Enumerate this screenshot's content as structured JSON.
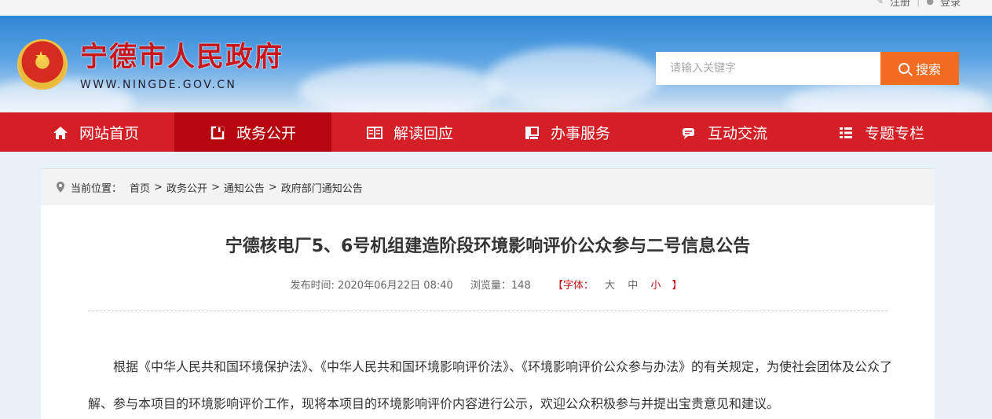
{
  "topbar": {
    "register": "注册",
    "separator": "|",
    "login": "登录"
  },
  "header": {
    "title": "宁德市人民政府",
    "url": "WWW.NINGDE.GOV.CN",
    "search_placeholder": "请输入关键字",
    "search_button": "搜索"
  },
  "nav": {
    "items": [
      {
        "label": "网站首页",
        "icon": "home-icon"
      },
      {
        "label": "政务公开",
        "icon": "open-icon"
      },
      {
        "label": "解读回应",
        "icon": "book-icon"
      },
      {
        "label": "办事服务",
        "icon": "service-icon"
      },
      {
        "label": "互动交流",
        "icon": "chat-icon"
      },
      {
        "label": "专题专栏",
        "icon": "list-icon"
      }
    ]
  },
  "breadcrumb": {
    "prefix": "当前位置：",
    "items": [
      "首页",
      "政务公开",
      "通知公告",
      "政府部门通知公告"
    ],
    "arrow": ">"
  },
  "article": {
    "title": "宁德核电厂5、6号机组建造阶段环境影响评价公众参与二号信息公告",
    "published": "发布时间: 2020年06月22日 08:40",
    "views": "浏览量：148",
    "font_open": "【字体：",
    "font_large": "大",
    "font_medium": "中",
    "font_small": "小",
    "font_close": "】",
    "paragraph": "根据《中华人民共和国环境保护法》、《中华人民共和国环境影响评价法》、《环境影响评价公众参与办法》的有关规定，为使社会团体及公众了解、参与本项目的环境影响评价工作，现将本项目的环境影响评价内容进行公示，欢迎公众积极参与并提出宝贵意见和建议。"
  },
  "colors": {
    "brand_red": "#d41f26",
    "nav_active": "#b7070e",
    "search_orange": "#f26d21"
  }
}
